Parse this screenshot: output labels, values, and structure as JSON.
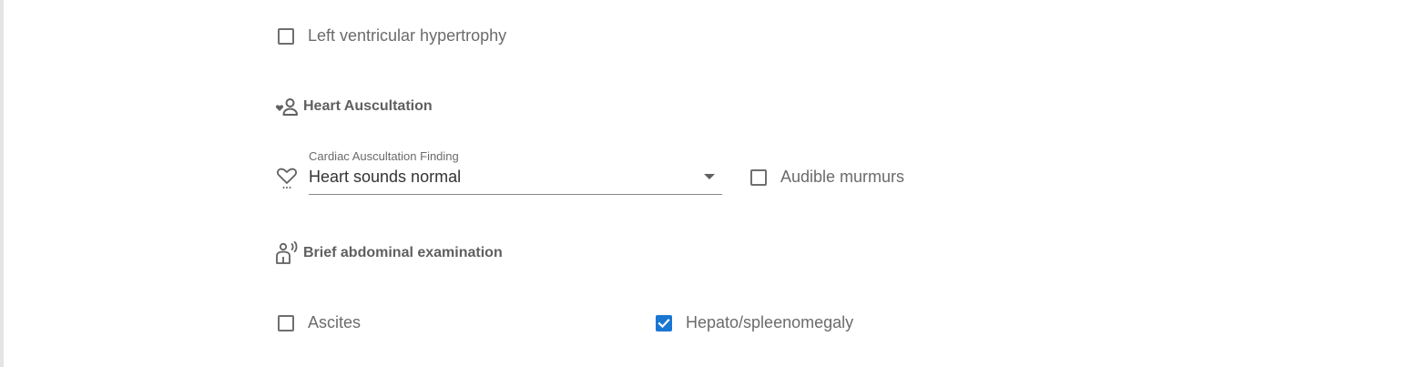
{
  "cardiac": {
    "lvh_label": "Left ventricular hypertrophy",
    "lvh_checked": false
  },
  "heart_auscultation": {
    "title": "Heart Auscultation",
    "title_icon": "heart-person-icon",
    "finding_label": "Cardiac Auscultation Finding",
    "finding_value": "Heart sounds normal",
    "finding_icon": "heart-outline-icon",
    "murmurs_label": "Audible murmurs",
    "murmurs_checked": false
  },
  "abdominal": {
    "title": "Brief abdominal examination",
    "title_icon": "person-examination-icon",
    "ascites_label": "Ascites",
    "ascites_checked": false,
    "hepato_label": "Hepato/spleenomegaly",
    "hepato_checked": true
  },
  "colors": {
    "accent": "#1976d2",
    "text_muted": "#6b6b6b",
    "text_dark": "#333333"
  }
}
